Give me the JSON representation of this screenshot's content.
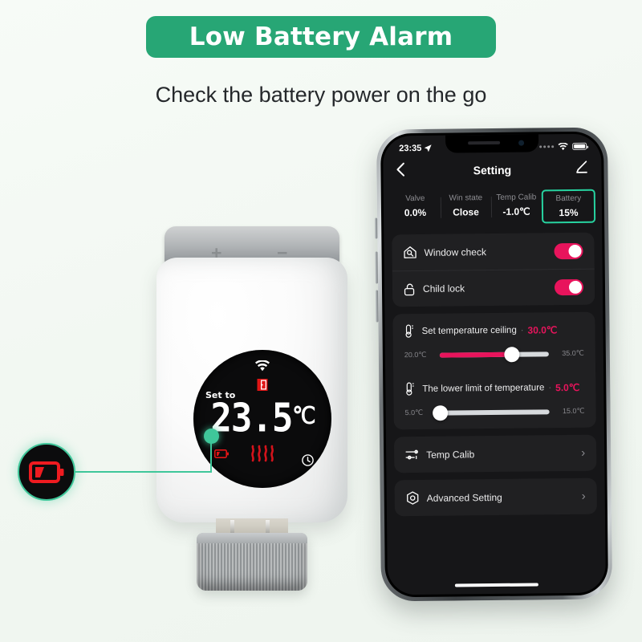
{
  "header": {
    "badge_title": "Low Battery Alarm",
    "subtitle": "Check the battery power on the go",
    "badge_color": "#27a675"
  },
  "device": {
    "plus_label": "+",
    "minus_label": "−",
    "display": {
      "set_to_label": "Set to",
      "temperature": "23.5",
      "unit": "℃",
      "icons": [
        "wifi-icon",
        "open-window-icon",
        "heat-waves-icon",
        "low-battery-icon",
        "clock-icon"
      ]
    }
  },
  "callout": {
    "icon_name": "low-battery-icon",
    "icon_color": "#ef1b20",
    "ring_color": "#3fc79a"
  },
  "phone": {
    "statusbar": {
      "time": "23:35",
      "location_icon": "location-arrow-icon",
      "wifi_icon": "wifi-icon",
      "battery_icon": "battery-full-icon"
    },
    "navbar": {
      "back_icon": "chevron-left-icon",
      "title": "Setting",
      "edit_icon": "pencil-edit-icon"
    },
    "stats": [
      {
        "key": "Valve",
        "value": "0.0%",
        "highlight": false
      },
      {
        "key": "Win state",
        "value": "Close",
        "highlight": false
      },
      {
        "key": "Temp Calib",
        "value": "-1.0℃",
        "highlight": false
      },
      {
        "key": "Battery",
        "value": "15%",
        "highlight": true
      }
    ],
    "highlight_color": "#27d3a0",
    "toggles": [
      {
        "icon": "window-check-icon",
        "label": "Window check",
        "on": true
      },
      {
        "icon": "child-lock-icon",
        "label": "Child lock",
        "on": true
      }
    ],
    "sliders": [
      {
        "icon": "thermometer-icon",
        "label": "Set temperature ceiling",
        "separator": "·",
        "value": "30.0℃",
        "min_label": "20.0℃",
        "max_label": "35.0℃",
        "percent": 66
      },
      {
        "icon": "thermometer-icon",
        "label": "The lower limit of temperature",
        "separator": "·",
        "value": "5.0℃",
        "min_label": "5.0℃",
        "max_label": "15.0℃",
        "percent": 0
      }
    ],
    "menu": [
      {
        "icon": "sliders-icon",
        "label": "Temp Calib",
        "chevron": "›"
      },
      {
        "icon": "advanced-setting-icon",
        "label": "Advanced Setting",
        "chevron": "›"
      }
    ],
    "accent_color": "#e8145c"
  }
}
